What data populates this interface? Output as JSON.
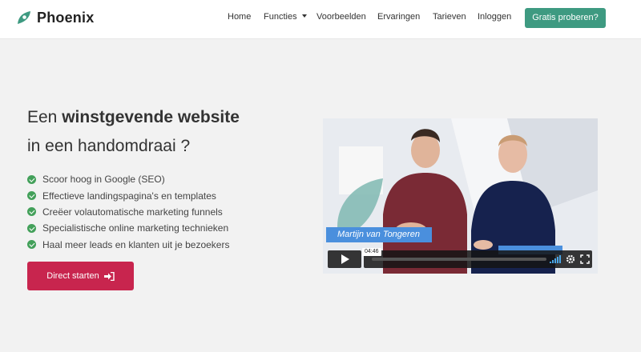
{
  "brand": {
    "name": "Phoenix",
    "color": "#3e9a81"
  },
  "nav": {
    "items": [
      {
        "label": "Home"
      },
      {
        "label": "Functies",
        "has_dropdown": true
      },
      {
        "label": "Voorbeelden"
      },
      {
        "label": "Ervaringen"
      },
      {
        "label": "Tarieven"
      },
      {
        "label": "Inloggen"
      }
    ],
    "cta": "Gratis proberen?"
  },
  "hero": {
    "headline_prefix": "Een ",
    "headline_bold": "winstgevende website",
    "headline_line2": "in een handomdraai ?",
    "features": [
      "Scoor hoog in Google (SEO)",
      "Effectieve landingspagina's en templates",
      "Creëer volautomatische marketing funnels",
      "Specialistische online marketing technieken",
      "Haal meer leads en klanten uit je bezoekers"
    ],
    "cta": "Direct starten",
    "cta_color": "#c8254e"
  },
  "video": {
    "name_tag": "Martijn van Tongeren",
    "time": "04:46",
    "accent": "#4a8fdd"
  }
}
